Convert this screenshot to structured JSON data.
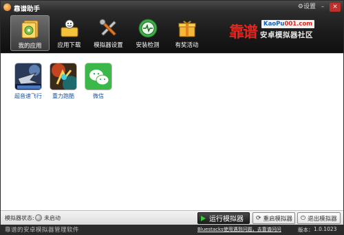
{
  "window": {
    "title": "靠谱助手",
    "settings_label": "设置",
    "minimize_label": "–",
    "close_label": "×"
  },
  "nav": {
    "items": [
      {
        "label": "我的应用",
        "icon": "my-apps-icon",
        "active": true
      },
      {
        "label": "应用下载",
        "icon": "app-download-icon",
        "active": false
      },
      {
        "label": "模拟器设置",
        "icon": "emulator-settings-icon",
        "active": false
      },
      {
        "label": "安装检测",
        "icon": "install-check-icon",
        "active": false
      },
      {
        "label": "有奖活动",
        "icon": "prize-activity-icon",
        "active": false
      }
    ]
  },
  "brand": {
    "name": "靠谱",
    "url_main": "KaoPu",
    "url_accent": "001.com",
    "subtitle": "安卓模拟器社区"
  },
  "apps": [
    {
      "name": "超音速飞行",
      "icon": "supersonic-flight-app-icon"
    },
    {
      "name": "重力跑酷",
      "icon": "gravity-parkour-app-icon"
    },
    {
      "name": "微信",
      "icon": "wechat-app-icon"
    }
  ],
  "status": {
    "label": "模拟器状态:",
    "value": "未启动"
  },
  "buttons": {
    "run": "运行模拟器",
    "restart": "重启模拟器",
    "exit": "退出模拟器"
  },
  "footer": {
    "left_text": "靠谱的安卓模拟器管理软件",
    "link_text": "Bluestacks使用遇到问题，去靠谱问问",
    "version_label": "版本：",
    "version": "1.0.1023"
  },
  "colors": {
    "brand_red": "#e0261e",
    "link_blue": "#1a4f9c",
    "run_green": "#2fd12f",
    "topbar_dark": "#1b1b1b"
  }
}
